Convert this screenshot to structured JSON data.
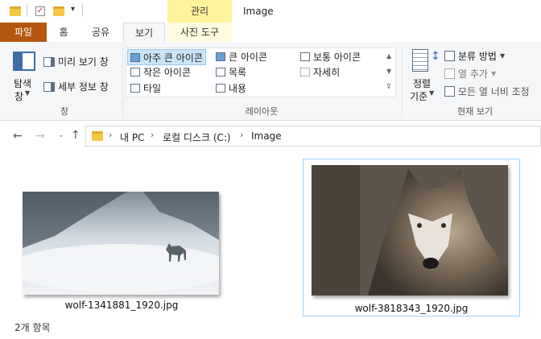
{
  "titlebar": {
    "contextual_tab": "관리",
    "window_title": "Image"
  },
  "tabs": [
    {
      "label": "파일"
    },
    {
      "label": "홈"
    },
    {
      "label": "공유"
    },
    {
      "label": "보기"
    },
    {
      "label": "사진 도구"
    }
  ],
  "ribbon": {
    "pane_group": {
      "nav_pane_label": "탐색",
      "nav_pane_label2": "창",
      "preview_pane": "미리 보기 창",
      "details_pane": "세부 정보 창",
      "group_label": "창"
    },
    "layout_group": {
      "items": [
        {
          "label": "아주 큰 아이콘"
        },
        {
          "label": "큰 아이콘"
        },
        {
          "label": "보통 아이콘"
        },
        {
          "label": "작은 아이콘"
        },
        {
          "label": "목록"
        },
        {
          "label": "자세히"
        },
        {
          "label": "타일"
        },
        {
          "label": "내용"
        }
      ],
      "group_label": "레이아웃"
    },
    "view_group": {
      "sort_label": "정렬",
      "sort_label2": "기준",
      "group_by": "분류 방법",
      "add_columns": "열 추가",
      "fit_columns": "모든 열 너비 조정",
      "group_label": "현재 보기"
    }
  },
  "address": {
    "crumbs": [
      "내 PC",
      "로컬 디스크 (C:)",
      "Image"
    ]
  },
  "files": [
    {
      "name": "wolf-1341881_1920.jpg"
    },
    {
      "name": "wolf-3818343_1920.jpg"
    }
  ],
  "status": {
    "count": "2개 항목"
  },
  "colors": {
    "file_tab": "#b5560f",
    "contextual": "#fff39c",
    "selection": "#cce4f7"
  }
}
